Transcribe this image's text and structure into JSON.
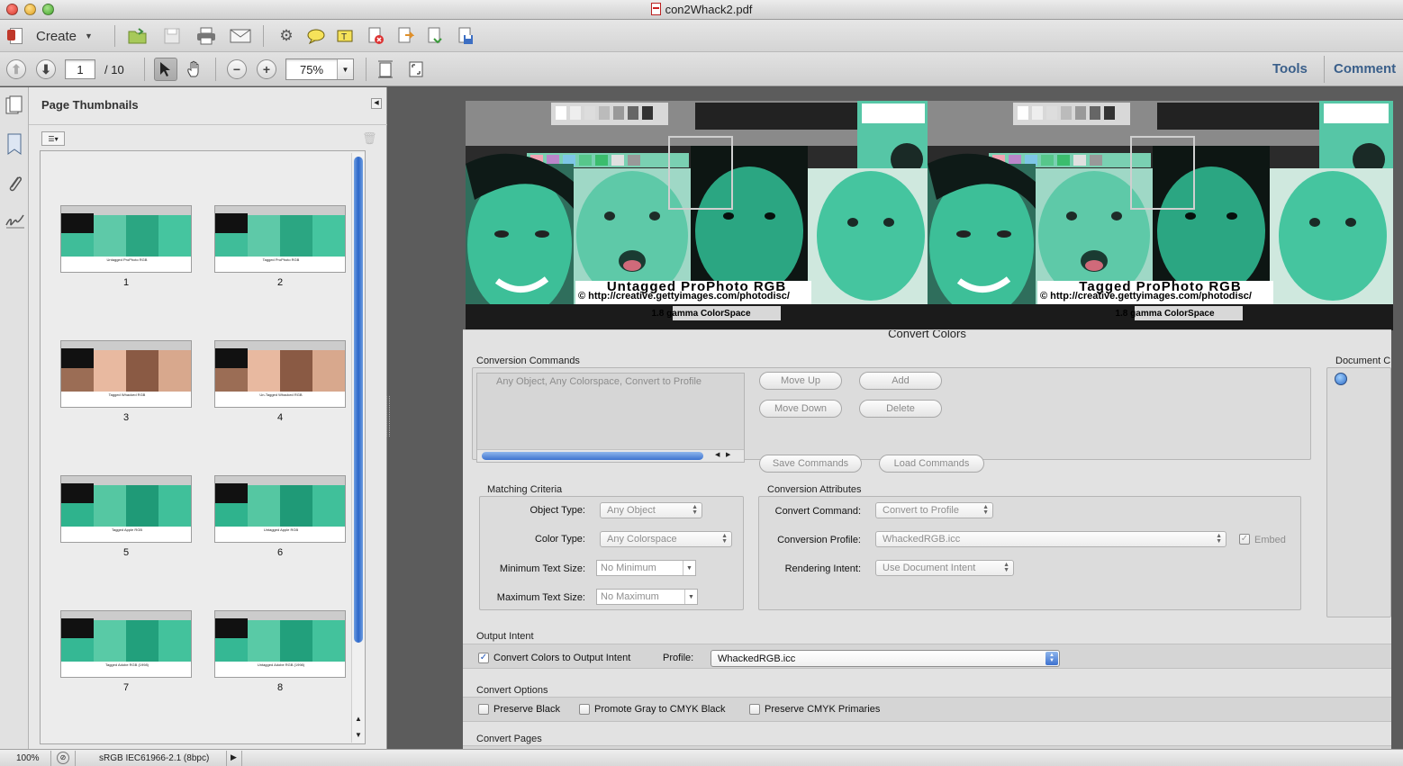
{
  "window": {
    "title": "con2Whack2.pdf"
  },
  "toolbar": {
    "create_label": "Create"
  },
  "nav": {
    "page_value": "1",
    "page_total": "/ 10",
    "zoom_value": "75%"
  },
  "right_tabs": {
    "tools": "Tools",
    "comment": "Comment"
  },
  "thumbnails": {
    "title": "Page Thumbnails",
    "pages": [
      {
        "num": "1",
        "caption": "Untagged ProPhoto RGB"
      },
      {
        "num": "2",
        "caption": "Tagged ProPhoto RGB"
      },
      {
        "num": "3",
        "caption": "Tagged Whacked RGB"
      },
      {
        "num": "4",
        "caption": "Un-Tagged Whacked RGB"
      },
      {
        "num": "5",
        "caption": "Tagged Apple RGB"
      },
      {
        "num": "6",
        "caption": "Untagged Apple RGB"
      },
      {
        "num": "7",
        "caption": "Tagged Adobe RGB (1998)"
      },
      {
        "num": "8",
        "caption": "Untagged Adobe RGB (1998)"
      }
    ]
  },
  "document": {
    "left": {
      "title": "Untagged ProPhoto RGB",
      "url": "© http://creative.gettyimages.com/photodisc/",
      "gamma": "1.8 gamma ColorSpace"
    },
    "right": {
      "title": "Tagged ProPhoto RGB",
      "url": "© http://creative.gettyimages.com/photodisc/",
      "gamma": "1.8 gamma ColorSpace"
    }
  },
  "dialog": {
    "title": "Convert Colors",
    "conversion_commands": {
      "label": "Conversion Commands",
      "item": "Any Object, Any Colorspace, Convert to Profile",
      "move_up": "Move Up",
      "add": "Add",
      "move_down": "Move Down",
      "delete": "Delete",
      "save": "Save Commands",
      "load": "Load Commands"
    },
    "document_colors_label": "Document C",
    "matching_criteria": {
      "label": "Matching Criteria",
      "object_type_label": "Object Type:",
      "object_type_value": "Any Object",
      "color_type_label": "Color Type:",
      "color_type_value": "Any Colorspace",
      "min_text_label": "Minimum Text Size:",
      "min_text_value": "No Minimum",
      "max_text_label": "Maximum Text Size:",
      "max_text_value": "No Maximum"
    },
    "conversion_attributes": {
      "label": "Conversion Attributes",
      "command_label": "Convert Command:",
      "command_value": "Convert to Profile",
      "profile_label": "Conversion Profile:",
      "profile_value": "WhackedRGB.icc",
      "embed_label": "Embed",
      "intent_label": "Rendering Intent:",
      "intent_value": "Use Document Intent"
    },
    "output_intent": {
      "label": "Output Intent",
      "convert_label": "Convert Colors to Output Intent",
      "profile_label": "Profile:",
      "profile_value": "WhackedRGB.icc"
    },
    "convert_options": {
      "label": "Convert Options",
      "preserve_black": "Preserve Black",
      "promote_gray": "Promote Gray to CMYK Black",
      "preserve_cmyk": "Preserve CMYK Primaries"
    },
    "convert_pages_label": "Convert Pages"
  },
  "statusbar": {
    "zoom": "100%",
    "profile": "sRGB IEC61966-2.1 (8bpc)"
  }
}
